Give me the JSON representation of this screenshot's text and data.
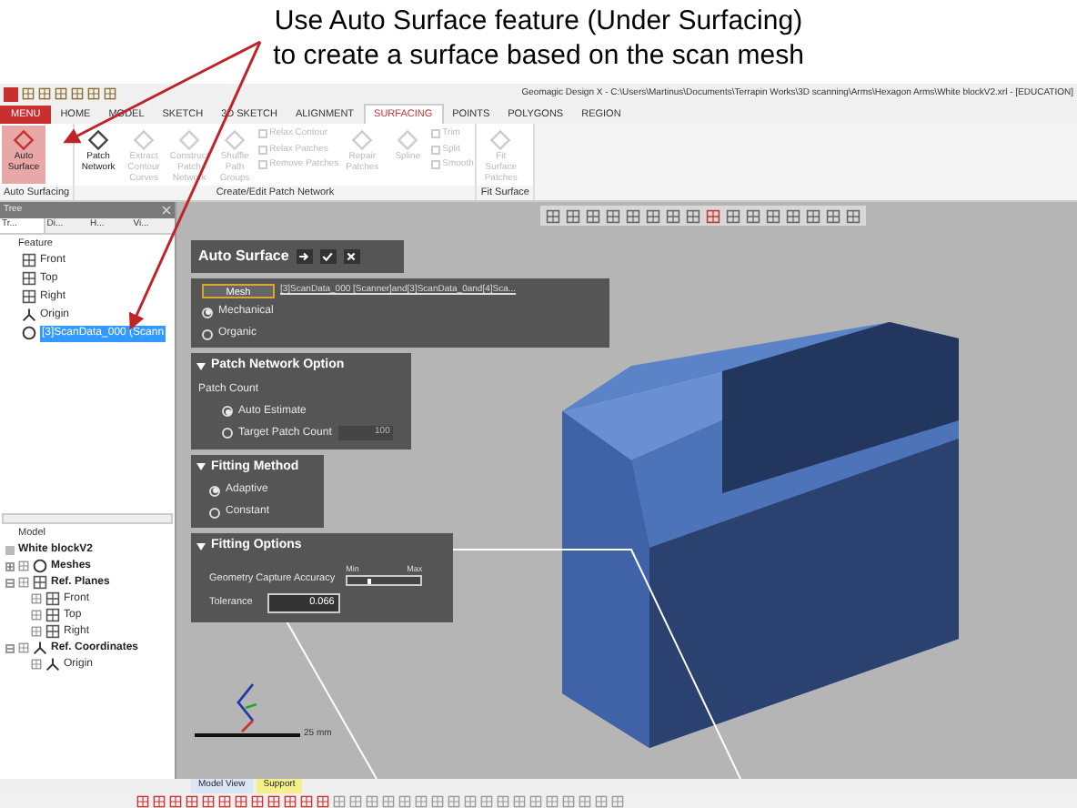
{
  "caption": [
    "Use Auto Surface feature (Under Surfacing)",
    "to create a surface based on the scan mesh"
  ],
  "window": {
    "title": "Geomagic Design X - C:\\Users\\Martinus\\Documents\\Terrapin Works\\3D scanning\\Arms\\Hexagon Arms\\White blockV2.xrl - [EDUCATION]"
  },
  "menu_tabs": [
    {
      "label": "MENU",
      "kind": "menu",
      "selected": false
    },
    {
      "label": "HOME",
      "kind": "tab",
      "selected": false
    },
    {
      "label": "MODEL",
      "kind": "tab",
      "selected": false
    },
    {
      "label": "SKETCH",
      "kind": "tab",
      "selected": false
    },
    {
      "label": "3D SKETCH",
      "kind": "tab",
      "selected": false
    },
    {
      "label": "ALIGNMENT",
      "kind": "tab",
      "selected": false
    },
    {
      "label": "SURFACING",
      "kind": "tab",
      "selected": true
    },
    {
      "label": "POINTS",
      "kind": "tab",
      "selected": false
    },
    {
      "label": "POLYGONS",
      "kind": "tab",
      "selected": false
    },
    {
      "label": "REGION",
      "kind": "tab",
      "selected": false
    }
  ],
  "ribbon": [
    {
      "label": "Auto Surfacing",
      "items": [
        {
          "kind": "large",
          "label": "Auto Surface",
          "selected": true,
          "disabled": false
        }
      ]
    },
    {
      "label": "Create/Edit Patch Network",
      "items": [
        {
          "kind": "large",
          "label": "Patch Network",
          "selected": false,
          "disabled": false
        },
        {
          "kind": "large",
          "label": "Extract Contour Curves",
          "selected": false,
          "disabled": true
        },
        {
          "kind": "large",
          "label": "Construct Patch Network",
          "selected": false,
          "disabled": true
        },
        {
          "kind": "large",
          "label": "Shuffle Path Groups",
          "selected": false,
          "disabled": true
        },
        {
          "kind": "stack",
          "items": [
            {
              "label": "Relax Contour",
              "disabled": true
            },
            {
              "label": "Relax Patches",
              "disabled": true
            },
            {
              "label": "Remove Patches",
              "disabled": true
            }
          ]
        },
        {
          "kind": "large",
          "label": "Repair Patches",
          "selected": false,
          "disabled": true
        },
        {
          "kind": "large",
          "label": "Spline",
          "selected": false,
          "disabled": true
        },
        {
          "kind": "stack",
          "items": [
            {
              "label": "Trim",
              "disabled": true
            },
            {
              "label": "Split",
              "disabled": true
            },
            {
              "label": "Smooth",
              "disabled": true
            }
          ]
        }
      ]
    },
    {
      "label": "Fit Surface",
      "items": [
        {
          "kind": "large",
          "label": "Fit Surface Patches",
          "selected": false,
          "disabled": true
        }
      ]
    }
  ],
  "tree_panel": {
    "title": "Tree",
    "tabs": [
      {
        "label": "Tr...",
        "selected": true
      },
      {
        "label": "Di...",
        "selected": false
      },
      {
        "label": "H...",
        "selected": false
      },
      {
        "label": "Vi...",
        "selected": false
      }
    ],
    "section": "Feature",
    "items": [
      {
        "kind": "plane",
        "label": "Front",
        "selected": false
      },
      {
        "kind": "plane",
        "label": "Top",
        "selected": false
      },
      {
        "kind": "plane",
        "label": "Right",
        "selected": false
      },
      {
        "kind": "origin",
        "label": "Origin",
        "selected": false
      },
      {
        "kind": "mesh",
        "label": "[3]ScanData_000 (Scann",
        "selected": true
      }
    ]
  },
  "model_panel": {
    "title": "Model",
    "root": "White blockV2",
    "children": [
      {
        "kind": "mesh",
        "label": "Meshes",
        "expanded": false
      },
      {
        "kind": "plane",
        "label": "Ref. Planes",
        "expanded": true,
        "children": [
          {
            "kind": "plane",
            "label": "Front"
          },
          {
            "kind": "plane",
            "label": "Top"
          },
          {
            "kind": "plane",
            "label": "Right"
          }
        ]
      },
      {
        "kind": "origin",
        "label": "Ref. Coordinates",
        "expanded": true,
        "children": [
          {
            "kind": "origin",
            "label": "Origin"
          }
        ]
      }
    ]
  },
  "auto_surface": {
    "title": "Auto Surface",
    "mesh_button": "Mesh",
    "mesh_value": "[3]ScanData_000 [Scanner]and[3]ScanData_0and[4]Sca...",
    "types": [
      {
        "label": "Mechanical",
        "selected": true
      },
      {
        "label": "Organic",
        "selected": false
      }
    ],
    "patch_network": {
      "title": "Patch Network Option",
      "group": "Patch Count",
      "options": [
        {
          "label": "Auto Estimate",
          "selected": true
        },
        {
          "label": "Target Patch Count",
          "selected": false
        }
      ],
      "count": "100"
    },
    "fitting_method": {
      "title": "Fitting Method",
      "options": [
        {
          "label": "Adaptive",
          "selected": true
        },
        {
          "label": "Constant",
          "selected": false
        }
      ]
    },
    "fitting_options": {
      "title": "Fitting Options",
      "accuracy_label": "Geometry Capture Accuracy",
      "min": "Min",
      "max": "Max",
      "level": 0.3,
      "tolerance_label": "Tolerance",
      "tolerance": "0.066"
    }
  },
  "viewport": {
    "scale": "25 mm"
  },
  "bottom_tabs": [
    {
      "label": "Model View",
      "color": "#dbe6f4"
    },
    {
      "label": "Support",
      "color": "#f4f08a"
    }
  ]
}
